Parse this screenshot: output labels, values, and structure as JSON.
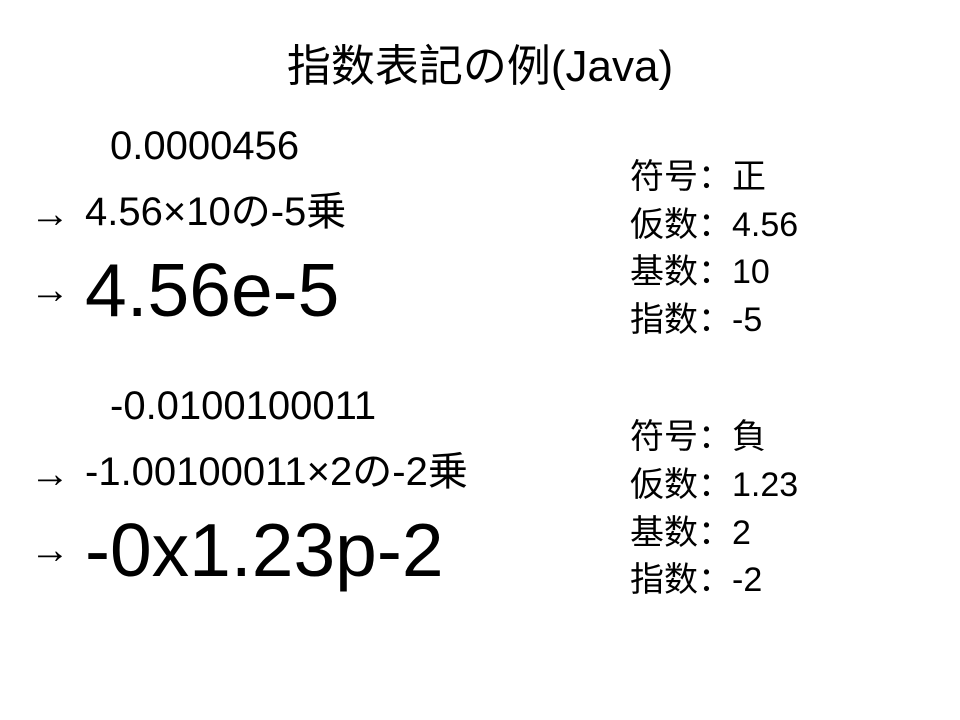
{
  "title": "指数表記の例(Java)",
  "example1": {
    "value": "0.0000456",
    "expanded": "4.56×10の-5乗",
    "notation": "4.56e-5",
    "sign": "符号：正",
    "mantissa": "仮数：4.56",
    "base": "基数：10",
    "exponent": "指数：-5"
  },
  "example2": {
    "value": "-0.0100100011",
    "expanded": "-1.00100011×2の-2乗",
    "notation": "-0x1.23p-2",
    "sign": "符号：負",
    "mantissa": "仮数：1.23",
    "base": "基数：2",
    "exponent": "指数：-2"
  },
  "arrow": "→"
}
